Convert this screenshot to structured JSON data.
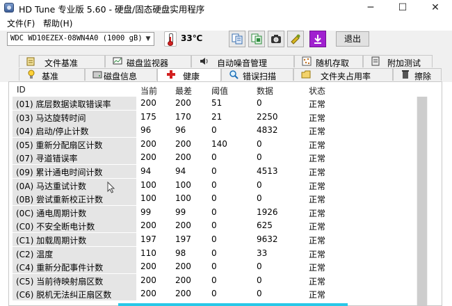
{
  "window": {
    "title": "HD Tune 专业版 5.60 - 硬盘/固态硬盘实用程序"
  },
  "window_controls": {
    "minimize": "─",
    "maximize": "☐",
    "close": "✕"
  },
  "menu": {
    "file": "文件(F)",
    "help": "帮助(H)"
  },
  "toolbar": {
    "drive": "WDC WD10EZEX-08WN4A0 (1000 gB)",
    "temperature": "33℃",
    "exit_label": "退出",
    "icons": [
      "copy-info-icon",
      "copy-screenshot-icon",
      "camera-icon",
      "options-icon",
      "save-download-icon"
    ]
  },
  "tabs_row1": [
    {
      "label": "文件基准",
      "icon": "file-benchmark-icon"
    },
    {
      "label": "磁盘监视器",
      "icon": "disk-monitor-icon"
    },
    {
      "label": "自动噪音管理",
      "icon": "aam-speaker-icon"
    },
    {
      "label": "随机存取",
      "icon": "random-access-icon"
    },
    {
      "label": "附加测试",
      "icon": "extra-tests-icon"
    }
  ],
  "tabs_row2": [
    {
      "label": "基准",
      "icon": "benchmark-icon"
    },
    {
      "label": "磁盘信息",
      "icon": "disk-info-icon"
    },
    {
      "label": "健康",
      "icon": "health-cross-icon"
    },
    {
      "label": "错误扫描",
      "icon": "error-scan-icon"
    },
    {
      "label": "文件夹占用率",
      "icon": "folder-usage-icon"
    },
    {
      "label": "擦除",
      "icon": "erase-icon"
    }
  ],
  "table": {
    "headers": {
      "id": "ID",
      "current": "当前",
      "worst": "最差",
      "threshold": "阈值",
      "data": "数据",
      "status": "状态"
    },
    "rows": [
      {
        "id": "(01) 底层数据读取错误率",
        "current": "200",
        "worst": "200",
        "threshold": "51",
        "data": "0",
        "status": "正常"
      },
      {
        "id": "(03) 马达旋转时间",
        "current": "175",
        "worst": "170",
        "threshold": "21",
        "data": "2250",
        "status": "正常"
      },
      {
        "id": "(04) 启动/停止计数",
        "current": "96",
        "worst": "96",
        "threshold": "0",
        "data": "4832",
        "status": "正常"
      },
      {
        "id": "(05) 重新分配扇区计数",
        "current": "200",
        "worst": "200",
        "threshold": "140",
        "data": "0",
        "status": "正常"
      },
      {
        "id": "(07) 寻道错误率",
        "current": "200",
        "worst": "200",
        "threshold": "0",
        "data": "0",
        "status": "正常"
      },
      {
        "id": "(09) 累计通电时间计数",
        "current": "94",
        "worst": "94",
        "threshold": "0",
        "data": "4513",
        "status": "正常"
      },
      {
        "id": "(0A) 马达重试计数",
        "current": "100",
        "worst": "100",
        "threshold": "0",
        "data": "0",
        "status": "正常"
      },
      {
        "id": "(0B) 尝试重新校正计数",
        "current": "100",
        "worst": "100",
        "threshold": "0",
        "data": "0",
        "status": "正常"
      },
      {
        "id": "(0C) 通电周期计数",
        "current": "99",
        "worst": "99",
        "threshold": "0",
        "data": "1926",
        "status": "正常"
      },
      {
        "id": "(C0) 不安全断电计数",
        "current": "200",
        "worst": "200",
        "threshold": "0",
        "data": "625",
        "status": "正常"
      },
      {
        "id": "(C1) 加载周期计数",
        "current": "197",
        "worst": "197",
        "threshold": "0",
        "data": "9632",
        "status": "正常"
      },
      {
        "id": "(C2) 温度",
        "current": "110",
        "worst": "98",
        "threshold": "0",
        "data": "33",
        "status": "正常"
      },
      {
        "id": "(C4) 重新分配事件计数",
        "current": "200",
        "worst": "200",
        "threshold": "0",
        "data": "0",
        "status": "正常"
      },
      {
        "id": "(C5) 当前待映射扇区数",
        "current": "200",
        "worst": "200",
        "threshold": "0",
        "data": "0",
        "status": "正常"
      },
      {
        "id": "(C6) 脱机无法纠正扇区数",
        "current": "200",
        "worst": "200",
        "threshold": "0",
        "data": "0",
        "status": "正常"
      }
    ]
  },
  "colors": {
    "status_strip": "#28c8e8",
    "accent_purple": "#a020d0",
    "health_red": "#d32020"
  }
}
